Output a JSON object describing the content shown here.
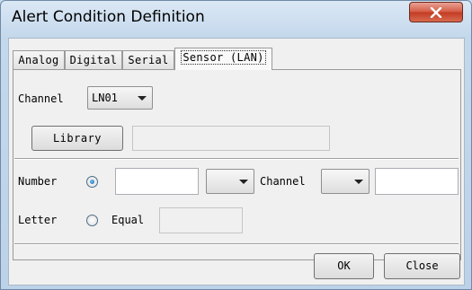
{
  "window": {
    "title": "Alert Condition Definition"
  },
  "tabs": [
    {
      "label": "Analog",
      "active": false
    },
    {
      "label": "Digital",
      "active": false
    },
    {
      "label": "Serial",
      "active": false
    },
    {
      "label": "Sensor (LAN)",
      "active": true
    }
  ],
  "channel": {
    "label": "Channel",
    "value": "LN01"
  },
  "library": {
    "button_label": "Library",
    "value": ""
  },
  "number_row": {
    "label": "Number",
    "selected": true,
    "value": "",
    "operator": "",
    "channel_label": "Channel",
    "channel_value": "",
    "compare_value": ""
  },
  "letter_row": {
    "label": "Letter",
    "selected": false,
    "equal_label": "Equal",
    "value": ""
  },
  "buttons": {
    "ok": "OK",
    "close": "Close"
  }
}
